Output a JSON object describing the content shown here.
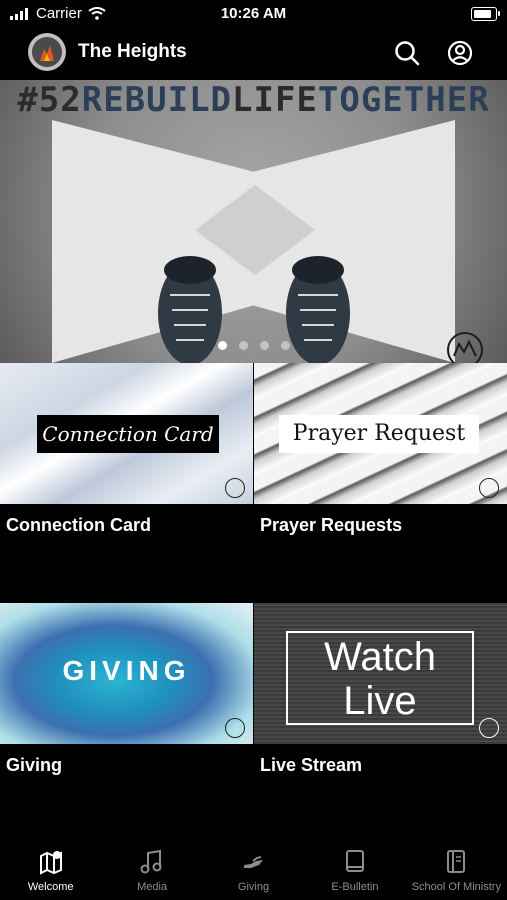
{
  "status_bar": {
    "carrier": "Carrier",
    "time": "10:26 AM"
  },
  "header": {
    "title": "The Heights"
  },
  "hero": {
    "hashtag_prefix": "#52",
    "hashtag_rebuild": "REBUILD",
    "hashtag_life": "LIFE",
    "hashtag_together": "TOGETHER",
    "slide_count": 4,
    "active_slide": 1
  },
  "tiles": [
    {
      "image_text": "Connection Card",
      "label": "Connection Card"
    },
    {
      "image_text": "Prayer Request",
      "label": "Prayer Requests"
    },
    {
      "image_text": "GIVING",
      "label": "Giving"
    },
    {
      "image_text_line1": "Watch",
      "image_text_line2": "Live",
      "label": "Live Stream"
    }
  ],
  "tabbar": {
    "items": [
      {
        "label": "Welcome",
        "icon": "map-pin-icon",
        "active": true
      },
      {
        "label": "Media",
        "icon": "music-note-icon",
        "active": false
      },
      {
        "label": "Giving",
        "icon": "giving-hand-icon",
        "active": false
      },
      {
        "label": "E-Bulletin",
        "icon": "book-icon",
        "active": false
      },
      {
        "label": "School Of Ministry",
        "icon": "bible-icon",
        "active": false
      }
    ]
  },
  "colors": {
    "background": "#000000",
    "inactive_tab": "#8d8d8d",
    "hashtag_blue": "#2d3f56"
  }
}
